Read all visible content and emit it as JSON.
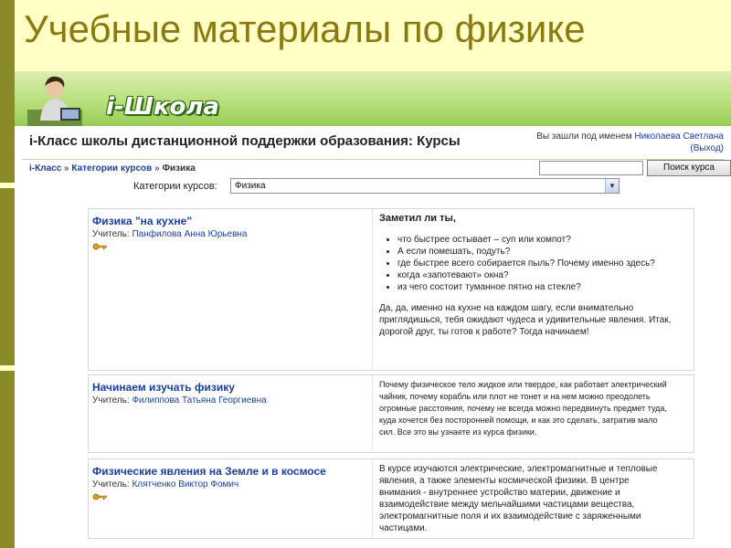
{
  "slide": {
    "title": "Учебные материалы по физике"
  },
  "banner": {
    "logo_text": "i-Школа"
  },
  "header": {
    "site_title": "i-Класс школы дистанционной поддержки образования: Курсы",
    "login_prefix": "Вы зашли под именем",
    "user_name": "Николаева Светлана",
    "logout_label": "(Выход)"
  },
  "breadcrumb": {
    "items": [
      "i-Класс",
      "Категории курсов",
      "Физика"
    ],
    "separator": "»"
  },
  "search": {
    "value": "",
    "button_label": "Поиск курса"
  },
  "category": {
    "label": "Категории курсов:",
    "selected": "Физика"
  },
  "courses": [
    {
      "name": "Физика \"на кухне\"",
      "teacher_prefix": "Учитель:",
      "teacher": "Панфилова Анна Юрьевна",
      "heading": "Заметил ли ты,",
      "bullets": [
        "что быстрее остывает – суп или компот?",
        "А если помешать, подуть?",
        "где быстрее всего собирается пыль? Почему именно здесь?",
        "когда «запотевают» окна?",
        "из чего состоит туманное пятно на стекле?"
      ],
      "text": "Да, да, именно на кухне на каждом шагу, если внимательно приглядишься, тебя ожидают чудеса и удивительные явления. Итак, дорогой друг, ты готов к работе? Тогда начинаем!"
    },
    {
      "name": "Начинаем изучать физику",
      "teacher_prefix": "Учитель:",
      "teacher": "Филиппова Татьяна Георгиевна",
      "text": "Почему физическое тело жидкое или твердое, как работает электрический чайник, почему корабль или плот не тонет и на нем можно преодолеть огромные расстояния, почему не всегда можно передвинуть предмет туда, куда хочется без посторонней помощи, и как это сделать, затратив мало сил. Все это вы узнаете из курса физики."
    },
    {
      "name": "Физические явления на Земле и в космосе",
      "teacher_prefix": "Учитель:",
      "teacher": "Клятченко Виктор Фомич",
      "text": "В курсе изучаются электрические, электромагнитные и тепловые явления, а также элементы космической физики. В центре внимания - внутреннее устройство материи, движение  и взаимодействие между мельчайшими частицами вещества, электромагнитные поля и их взаимодействие с заряженными частицами."
    }
  ],
  "colors": {
    "slide_background": "#ffffc6",
    "slide_title": "#8a7a10",
    "left_bar": "#8a8a28",
    "link": "#1a3fa0",
    "banner_green": "#98cc55"
  }
}
